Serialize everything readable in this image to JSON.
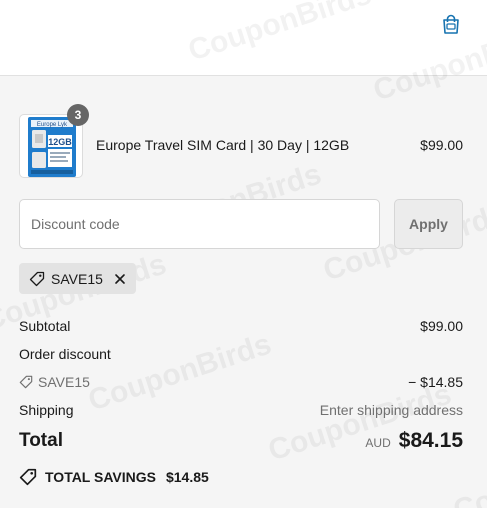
{
  "header": {
    "cart_icon": "shopping-bag-icon"
  },
  "product": {
    "name": "Europe Travel SIM Card | 30 Day | 12GB",
    "price": "$99.00",
    "quantity": "3",
    "thumbnail_label": "12GB",
    "thumbnail_brand": "Europe Lyk"
  },
  "discount": {
    "placeholder": "Discount code",
    "apply_label": "Apply",
    "applied_code": "SAVE15",
    "icons": {
      "tag": "tag-icon",
      "remove": "close-icon"
    }
  },
  "summary": {
    "subtotal_label": "Subtotal",
    "subtotal_value": "$99.00",
    "order_discount_label": "Order discount",
    "discount_code": "SAVE15",
    "discount_value": "− $14.85",
    "shipping_label": "Shipping",
    "shipping_value": "Enter shipping address",
    "total_label": "Total",
    "currency": "AUD",
    "total_value": "$84.15",
    "savings_label": "TOTAL SAVINGS",
    "savings_value": "$14.85"
  },
  "watermark_text": "CouponBirds",
  "colors": {
    "accent": "#1773b0",
    "text": "#1a1a1a",
    "muted": "#707070",
    "background": "#f5f5f5",
    "badge": "#666666"
  }
}
